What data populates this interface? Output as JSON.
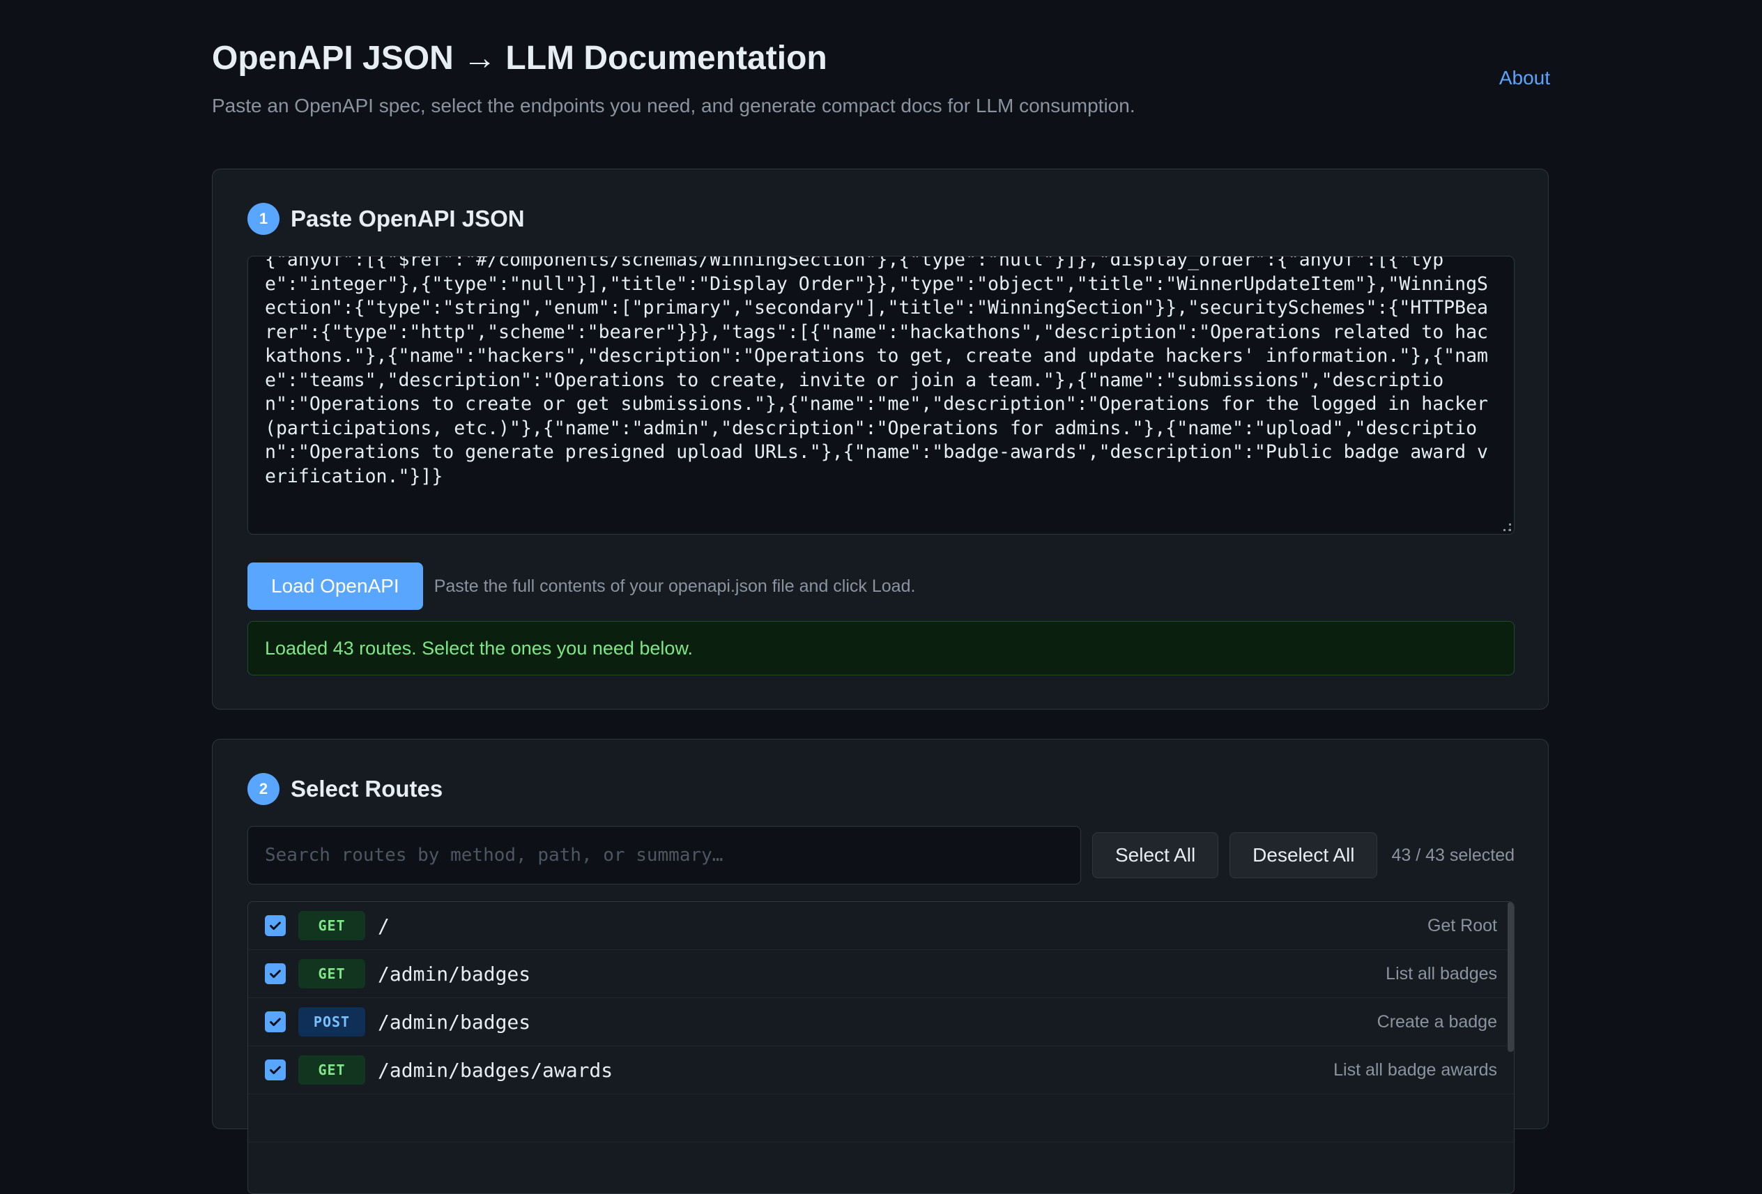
{
  "header": {
    "title": "OpenAPI JSON → LLM Documentation",
    "subtitle": "Paste an OpenAPI spec, select the endpoints you need, and generate compact docs for LLM consumption.",
    "about_link": "About"
  },
  "step1": {
    "number": "1",
    "title": "Paste OpenAPI JSON",
    "json_text": "{\"anyOf\":[{\"$ref\":\"#/components/schemas/WinningSection\"},{\"type\":\"null\"}]},\"display_order\":{\"anyOf\":[{\"type\":\"integer\"},{\"type\":\"null\"}],\"title\":\"Display Order\"}},\"type\":\"object\",\"title\":\"WinnerUpdateItem\"},\"WinningSection\":{\"type\":\"string\",\"enum\":[\"primary\",\"secondary\"],\"title\":\"WinningSection\"}},\"securitySchemes\":{\"HTTPBearer\":{\"type\":\"http\",\"scheme\":\"bearer\"}}},\"tags\":[{\"name\":\"hackathons\",\"description\":\"Operations related to hackathons.\"},{\"name\":\"hackers\",\"description\":\"Operations to get, create and update hackers' information.\"},{\"name\":\"teams\",\"description\":\"Operations to create, invite or join a team.\"},{\"name\":\"submissions\",\"description\":\"Operations to create or get submissions.\"},{\"name\":\"me\",\"description\":\"Operations for the logged in hacker (participations, etc.)\"},{\"name\":\"admin\",\"description\":\"Operations for admins.\"},{\"name\":\"upload\",\"description\":\"Operations to generate presigned upload URLs.\"},{\"name\":\"badge-awards\",\"description\":\"Public badge award verification.\"}]}",
    "load_button": "Load OpenAPI",
    "load_hint": "Paste the full contents of your openapi.json file and click Load.",
    "status_message": "Loaded 43 routes. Select the ones you need below."
  },
  "step2": {
    "number": "2",
    "title": "Select Routes",
    "search_placeholder": "Search routes by method, path, or summary…",
    "select_all": "Select All",
    "deselect_all": "Deselect All",
    "selected_count": "43 / 43 selected",
    "routes": [
      {
        "method": "GET",
        "path": "/",
        "summary": "Get Root",
        "checked": true
      },
      {
        "method": "GET",
        "path": "/admin/badges",
        "summary": "List all badges",
        "checked": true
      },
      {
        "method": "POST",
        "path": "/admin/badges",
        "summary": "Create a badge",
        "checked": true
      },
      {
        "method": "GET",
        "path": "/admin/badges/awards",
        "summary": "List all badge awards",
        "checked": true
      }
    ]
  },
  "colors": {
    "accent": "#58a6ff",
    "get_method": "#7ee787",
    "post_method": "#79c0ff",
    "success": "#7ee787"
  }
}
